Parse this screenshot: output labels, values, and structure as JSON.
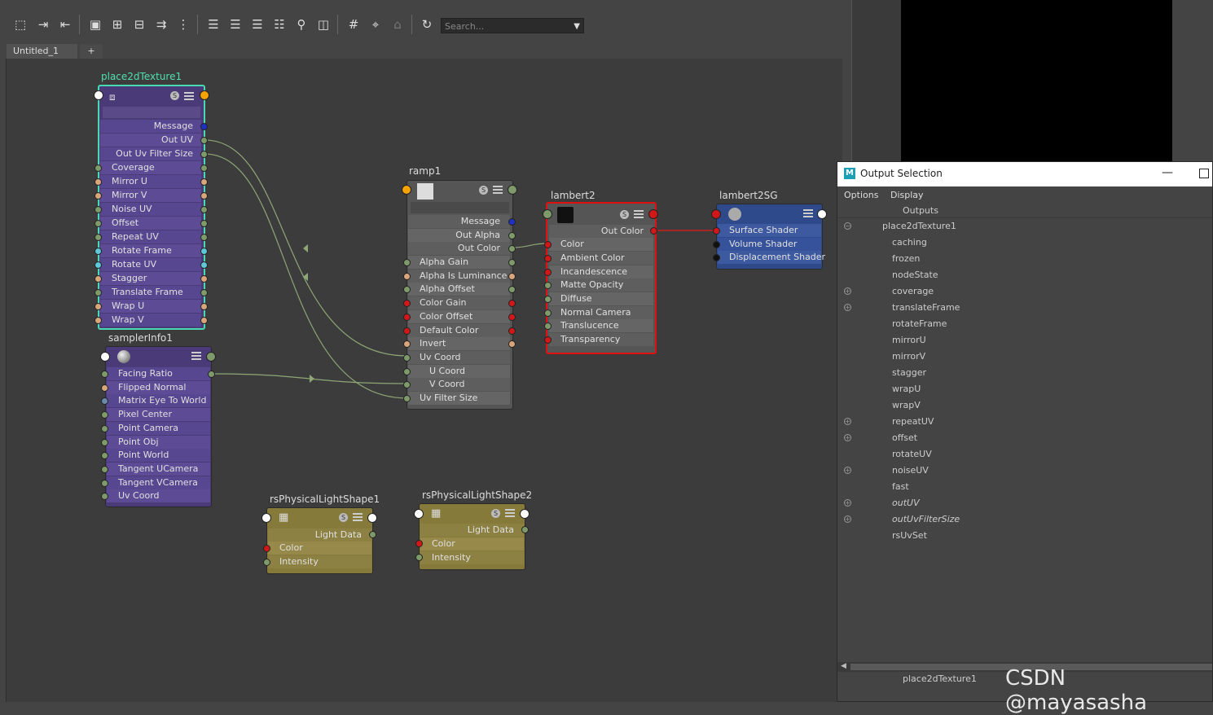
{
  "toolbar": {
    "search_placeholder": "Search...",
    "icons": [
      "frame-icon",
      "graph-in-icon",
      "graph-out-icon",
      "select-icon",
      "add-icon",
      "remove-icon",
      "connect-icon",
      "layout-icon",
      "simple-icon",
      "connected-icon",
      "full-icon",
      "custom-icon",
      "search-nodes-icon",
      "snapshot-icon",
      "grid-icon",
      "snap-icon",
      "hide-icon",
      "refresh-icon"
    ]
  },
  "tabs": [
    {
      "label": "Untitled_1"
    },
    {
      "label": "+"
    }
  ],
  "nodes": {
    "place2d": {
      "title": "place2dTexture1",
      "rows": [
        "Message",
        "Out UV",
        "Out Uv Filter Size",
        "Coverage",
        "Mirror U",
        "Mirror V",
        "Noise UV",
        "Offset",
        "Repeat UV",
        "Rotate Frame",
        "Rotate UV",
        "Stagger",
        "Translate Frame",
        "Wrap U",
        "Wrap V"
      ]
    },
    "sampler": {
      "title": "samplerInfo1",
      "rows": [
        "Facing Ratio",
        "Flipped Normal",
        "Matrix Eye To World",
        "Pixel Center",
        "Point Camera",
        "Point Obj",
        "Point World",
        "Tangent UCamera",
        "Tangent VCamera",
        "Uv Coord"
      ]
    },
    "ramp": {
      "title": "ramp1",
      "rows": [
        "Message",
        "Out Alpha",
        "Out Color",
        "Alpha Gain",
        "Alpha Is Luminance",
        "Alpha Offset",
        "Color Gain",
        "Color Offset",
        "Default Color",
        "Invert",
        "Uv Coord",
        "U Coord",
        "V Coord",
        "Uv Filter Size"
      ]
    },
    "lambert": {
      "title": "lambert2",
      "rows": [
        "Out Color",
        "Color",
        "Ambient Color",
        "Incandescence",
        "Matte Opacity",
        "Diffuse",
        "Normal Camera",
        "Translucence",
        "Transparency"
      ]
    },
    "sg": {
      "title": "lambert2SG",
      "rows": [
        "Surface Shader",
        "Volume Shader",
        "Displacement Shader"
      ]
    },
    "light1": {
      "title": "rsPhysicalLightShape1",
      "rows": [
        "Light Data",
        "Color",
        "Intensity"
      ]
    },
    "light2": {
      "title": "rsPhysicalLightShape2",
      "rows": [
        "Light Data",
        "Color",
        "Intensity"
      ]
    }
  },
  "output_selection": {
    "title": "Output Selection",
    "menu": [
      "Options",
      "Display"
    ],
    "header": "Outputs",
    "root": "place2dTexture1",
    "items": [
      "caching",
      "frozen",
      "nodeState",
      "coverage",
      "translateFrame",
      "rotateFrame",
      "mirrorU",
      "mirrorV",
      "stagger",
      "wrapU",
      "wrapV",
      "repeatUV",
      "offset",
      "rotateUV",
      "noiseUV",
      "fast",
      "outUV",
      "outUvFilterSize",
      "rsUvSet"
    ],
    "footer": "place2dTexture1"
  },
  "watermark": "CSDN @mayasasha"
}
